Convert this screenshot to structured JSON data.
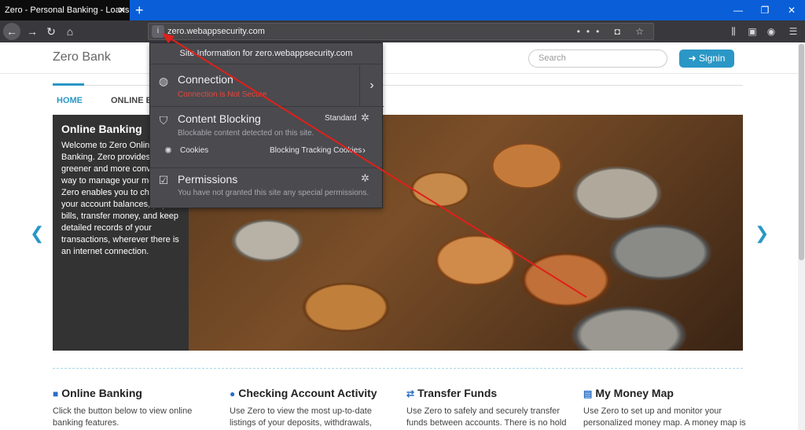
{
  "browser": {
    "tab_title": "Zero - Personal Banking - Loans - C",
    "tab_close": "✕",
    "new_tab": "+",
    "url_host": "zero.webappsecurity.com",
    "url_actions": "••• ◘ ☆"
  },
  "site": {
    "brand": "Zero Bank",
    "search_placeholder": "Search",
    "signin_label": "Signin",
    "nav": [
      "HOME",
      "ONLINE B"
    ]
  },
  "hero": {
    "title": "Online Banking",
    "text": "Welcome to Zero Online Banking. Zero provides a greener and more convenient way to manage your money. Zero enables you to check your account balances, pay bills, transfer money, and keep detailed records of your transactions, wherever there is an internet connection.",
    "prev": "❮",
    "next": "❯"
  },
  "features": [
    {
      "title": "Online Banking",
      "text": "Click the button below to view online banking features."
    },
    {
      "title": "Checking Account Activity",
      "text": "Use Zero to view the most up-to-date listings of your deposits, withdrawals,"
    },
    {
      "title": "Transfer Funds",
      "text": "Use Zero to safely and securely transfer funds between accounts. There is no hold"
    },
    {
      "title": "My Money Map",
      "text": "Use Zero to set up and monitor your personalized money map. A money map is"
    }
  ],
  "popup": {
    "header": "Site Information for zero.webappsecurity.com",
    "connection_title": "Connection",
    "connection_status": "Connection is Not Secure",
    "blocking_title": "Content Blocking",
    "blocking_level": "Standard",
    "blocking_sub": "Blockable content detected on this site.",
    "cookies_label": "Cookies",
    "cookies_value": "Blocking Tracking Cookies",
    "permissions_title": "Permissions",
    "permissions_sub": "You have not granted this site any special permissions."
  }
}
